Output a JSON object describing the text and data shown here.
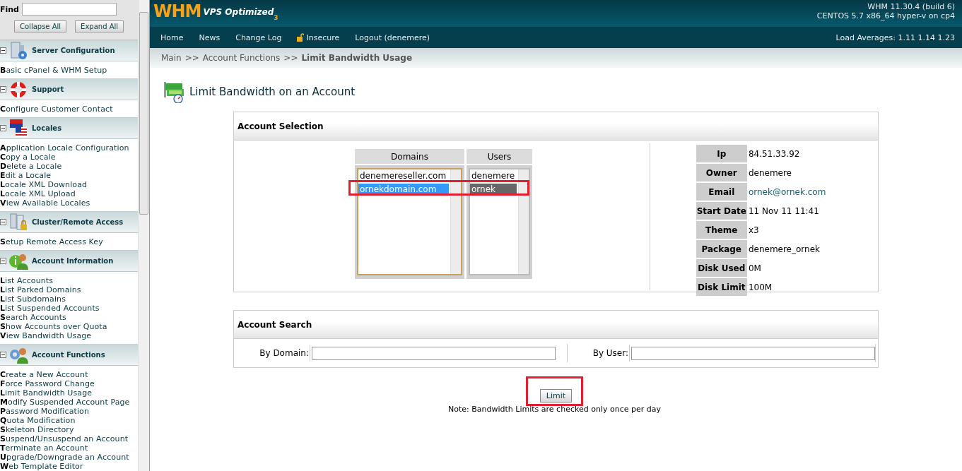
{
  "sidebar": {
    "find_label": "Find",
    "buttons": [
      "Collapse All",
      "Expand All"
    ],
    "sections": [
      {
        "title": "Server Configuration",
        "kind": "server",
        "expanded": true,
        "items": [
          "Basic cPanel & WHM Setup"
        ]
      },
      {
        "title": "Support",
        "kind": "support",
        "expanded": true,
        "items": [
          "Configure Customer Contact"
        ]
      },
      {
        "title": "Locales",
        "kind": "locales",
        "expanded": true,
        "items": [
          "Application Locale Configuration",
          "Copy a Locale",
          "Delete a Locale",
          "Edit a Locale",
          "Locale XML Download",
          "Locale XML Upload",
          "View Available Locales"
        ]
      },
      {
        "title": "Cluster/Remote Access",
        "kind": "cluster",
        "expanded": true,
        "items": [
          "Setup Remote Access Key"
        ]
      },
      {
        "title": "Account Information",
        "kind": "account-info",
        "expanded": true,
        "items": [
          "List Accounts",
          "List Parked Domains",
          "List Subdomains",
          "List Suspended Accounts",
          "Search Accounts",
          "Show Accounts over Quota",
          "View Bandwidth Usage"
        ]
      },
      {
        "title": "Account Functions",
        "kind": "account-functions",
        "expanded": true,
        "items": [
          "Create a New Account",
          "Force Password Change",
          "Limit Bandwidth Usage",
          "Modify Suspended Account Page",
          "Password Modification",
          "Quota Modification",
          "Skeleton Directory",
          "Suspend/Unsuspend an Account",
          "Terminate an Account",
          "Upgrade/Downgrade an Account",
          "Web Template Editor"
        ]
      }
    ]
  },
  "header": {
    "logo": "WHM",
    "logo_sub": "VPS Optimized",
    "logo_version": "3",
    "version": "WHM 11.30.4 (build 6)",
    "system": "CENTOS 5.7 x86_64 hyper-v on cp4"
  },
  "nav": [
    {
      "label": "Home",
      "kind": "link"
    },
    {
      "label": "News",
      "kind": "link"
    },
    {
      "label": "Change Log",
      "kind": "link"
    },
    {
      "label": "Insecure",
      "kind": "lock"
    },
    {
      "label": "Logout (denemere)",
      "kind": "link"
    }
  ],
  "load_averages": "Load Averages: 1.11 1.14 1.23",
  "breadcrumb": [
    "Main",
    ">>",
    "Account Functions",
    ">>",
    "Limit Bandwidth Usage"
  ],
  "page_title": "Limit Bandwidth on an Account",
  "account_selection": {
    "title": "Account Selection",
    "highlight_selected_row": true,
    "domains": {
      "heading": "Domains",
      "focused": true,
      "items": [
        {
          "label": "denemereseller.com",
          "selected": false
        },
        {
          "label": "ornekdomain.com",
          "selected": true
        }
      ]
    },
    "users": {
      "heading": "Users",
      "focused": false,
      "items": [
        {
          "label": "denemere",
          "selected": false
        },
        {
          "label": "ornek",
          "selected": true
        }
      ]
    },
    "details": [
      {
        "label": "Ip",
        "value": "84.51.33.92",
        "kind": "text"
      },
      {
        "label": "Owner",
        "value": "denemere",
        "kind": "text"
      },
      {
        "label": "Email",
        "value": "ornek@ornek.com",
        "kind": "link"
      },
      {
        "label": "Start Date",
        "value": "11 Nov 11 11:41",
        "kind": "text"
      },
      {
        "label": "Theme",
        "value": "x3",
        "kind": "text"
      },
      {
        "label": "Package",
        "value": "denemere_ornek",
        "kind": "text"
      },
      {
        "label": "Disk Used",
        "value": "0M",
        "kind": "text"
      },
      {
        "label": "Disk Limit",
        "value": "100M",
        "kind": "text"
      }
    ]
  },
  "account_search": {
    "title": "Account Search",
    "fields": [
      {
        "label": "By Domain:"
      },
      {
        "label": "By User:"
      }
    ]
  },
  "limit_button": {
    "label": "Limit",
    "highlighted": true
  },
  "note": "Note: Bandwidth Limits are checked only once per day"
}
